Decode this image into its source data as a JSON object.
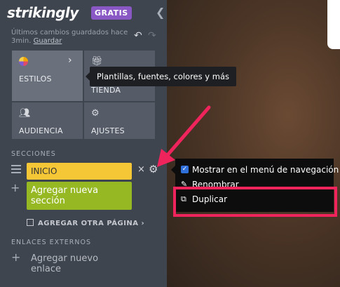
{
  "brand": {
    "logo": "strikingly",
    "plan_badge": "GRATIS"
  },
  "icons": {
    "collapse": "chevron-left-icon",
    "undo": "undo-icon",
    "redo": "redo-icon"
  },
  "status": {
    "saved_text": "Últimos cambios guardados hace 3min.",
    "save_link": "Guardar"
  },
  "tiles": [
    {
      "label": "ESTILOS",
      "icon": "palette-icon"
    },
    {
      "label": "TIENDA",
      "icon": "gift-icon"
    },
    {
      "label": "AUDIENCIA",
      "icon": "people-icon"
    },
    {
      "label": "AJUSTES",
      "icon": "gear-icon"
    }
  ],
  "tooltip": {
    "text": "Plantillas, fuentes, colores y más"
  },
  "sections": {
    "heading": "SECCIONES",
    "items": [
      {
        "label": "INICIO"
      }
    ],
    "add_label": "Agregar nueva sección",
    "add_page_label": "AGREGAR OTRA PÁGINA"
  },
  "external": {
    "heading": "ENLACES EXTERNOS",
    "add_label": "Agregar nuevo enlace"
  },
  "context_menu": {
    "items": [
      {
        "label": "Mostrar en el menú de navegación",
        "checked": true,
        "icon": "checkbox-icon"
      },
      {
        "label": "Renombrar",
        "icon": "pencil-icon"
      },
      {
        "label": "Duplicar",
        "icon": "copy-icon"
      }
    ]
  },
  "colors": {
    "sidebar": "#3f454f",
    "accent_purple": "#8a58c4",
    "section_yellow": "#f5c636",
    "add_green": "#96b823",
    "highlight": "#f0245c"
  }
}
